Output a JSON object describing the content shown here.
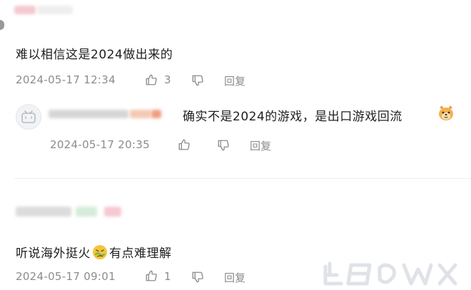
{
  "comments": [
    {
      "text": "难以相信这是2024做出来的",
      "timestamp": "2024-05-17 12:34",
      "like_count": "3",
      "reply_label": "回复",
      "reply": {
        "text": "确实不是2024的游戏，是出口游戏回流",
        "emoji": "dog-face-emoji",
        "timestamp": "2024-05-17 20:35",
        "reply_label": "回复"
      }
    },
    {
      "text_before": "听说海外挺火",
      "emoji": "sick-face-emoji",
      "text_after": "有点难理解",
      "timestamp": "2024-05-17 09:01",
      "like_count": "1",
      "reply_label": "回复"
    }
  ],
  "icons": {
    "like": "thumbs-up-icon",
    "dislike": "thumbs-down-icon",
    "avatar": "bilibili-tv-avatar"
  },
  "colors": {
    "meta": "#8c8c8c",
    "text": "#1f1f1f",
    "divider": "#eeeeee"
  }
}
